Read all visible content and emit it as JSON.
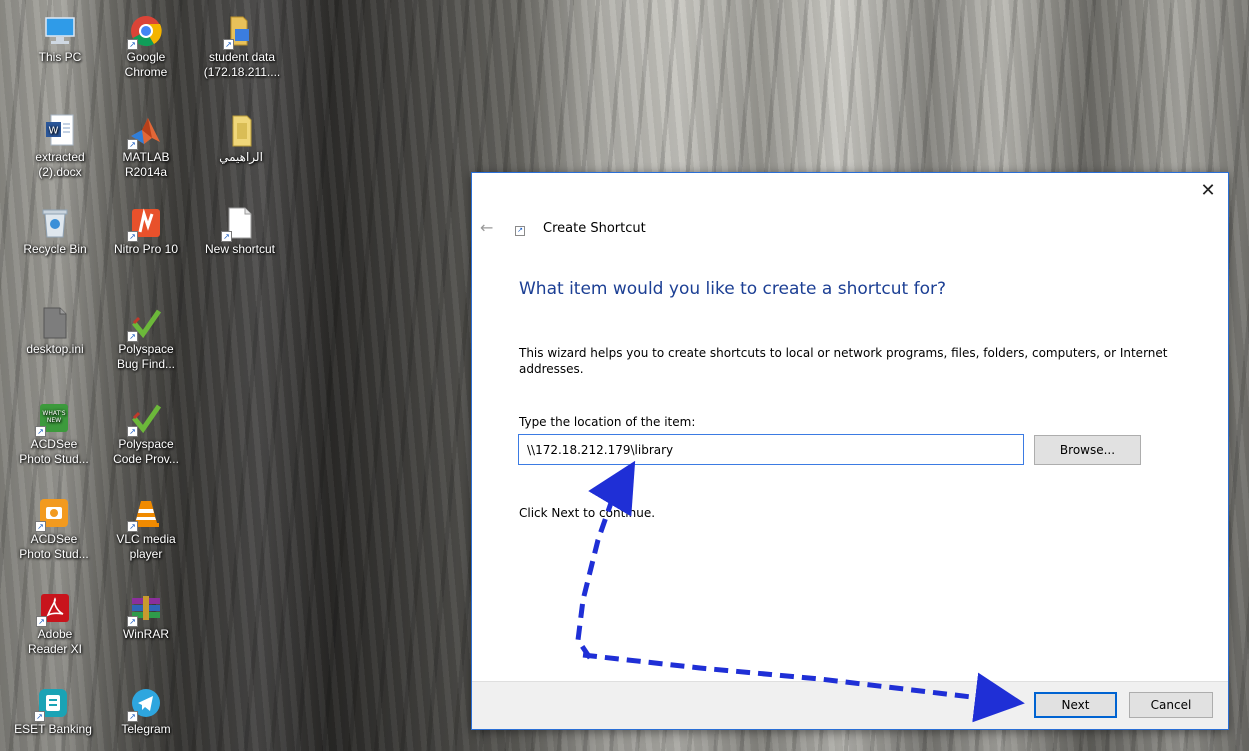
{
  "desktop": {
    "icons": [
      {
        "label": "This PC",
        "icon": "this-pc-icon"
      },
      {
        "label": "Google\nChrome",
        "icon": "chrome-icon"
      },
      {
        "label": "student data\n(172.18.211....",
        "icon": "folder-icon"
      },
      {
        "label": "extracted\n(2).docx",
        "icon": "word-doc-icon"
      },
      {
        "label": "MATLAB\nR2014a",
        "icon": "matlab-icon"
      },
      {
        "label": "الراهيمي",
        "icon": "folder-icon"
      },
      {
        "label": "Recycle Bin",
        "icon": "recycle-bin-icon"
      },
      {
        "label": "Nitro Pro 10",
        "icon": "nitro-icon"
      },
      {
        "label": "New shortcut",
        "icon": "blank-file-icon"
      },
      {
        "label": "desktop.ini",
        "icon": "ini-file-icon"
      },
      {
        "label": "Polyspace\nBug Find...",
        "icon": "polyspace-icon"
      },
      {
        "label": "ACDSee\nPhoto Stud...",
        "icon": "acdsee-whats-new-icon"
      },
      {
        "label": "Polyspace\nCode Prov...",
        "icon": "polyspace-icon"
      },
      {
        "label": "ACDSee\nPhoto Stud...",
        "icon": "acdsee-icon"
      },
      {
        "label": "VLC media\nplayer",
        "icon": "vlc-icon"
      },
      {
        "label": "Adobe\nReader XI",
        "icon": "adobe-reader-icon"
      },
      {
        "label": "WinRAR",
        "icon": "winrar-icon"
      },
      {
        "label": "ESET Banking",
        "icon": "eset-icon"
      },
      {
        "label": "Telegram",
        "icon": "telegram-icon"
      }
    ]
  },
  "dialog": {
    "close_glyph": "✕",
    "back_glyph": "←",
    "title": "Create Shortcut",
    "heading": "What item would you like to create a shortcut for?",
    "description": "This wizard helps you to create shortcuts to local or network programs, files, folders, computers, or Internet addresses.",
    "location_label": "Type the location of the item:",
    "location_value": "\\\\172.18.212.179\\library",
    "browse_label": "Browse...",
    "continue_text": "Click Next to continue.",
    "next_label": "Next",
    "cancel_label": "Cancel"
  },
  "colors": {
    "heading": "#1c3f94",
    "accent": "#0063d1",
    "annotation_arrow": "#1f2fd6"
  }
}
